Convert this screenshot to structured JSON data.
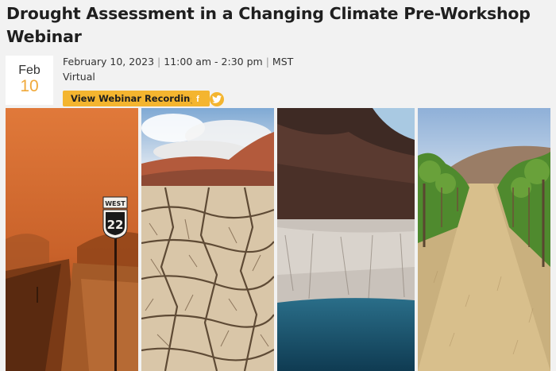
{
  "event": {
    "title": "Drought Assessment in a Changing Climate Pre-Workshop Webinar",
    "date_month": "Feb",
    "date_day": "10",
    "date_full": "February 10, 2023",
    "time": "11:00 am - 2:30 pm",
    "timezone": "MST",
    "location": "Virtual",
    "recordings_button": "View Webinar Recordings"
  },
  "sign": {
    "direction": "WEST",
    "route_number": "22"
  },
  "social": [
    {
      "name": "facebook",
      "glyph": "f"
    },
    {
      "name": "twitter",
      "glyph": "t"
    }
  ],
  "colors": {
    "accent": "#f4b52f",
    "day_number": "#f0a93a",
    "background": "#f2f2f2"
  }
}
